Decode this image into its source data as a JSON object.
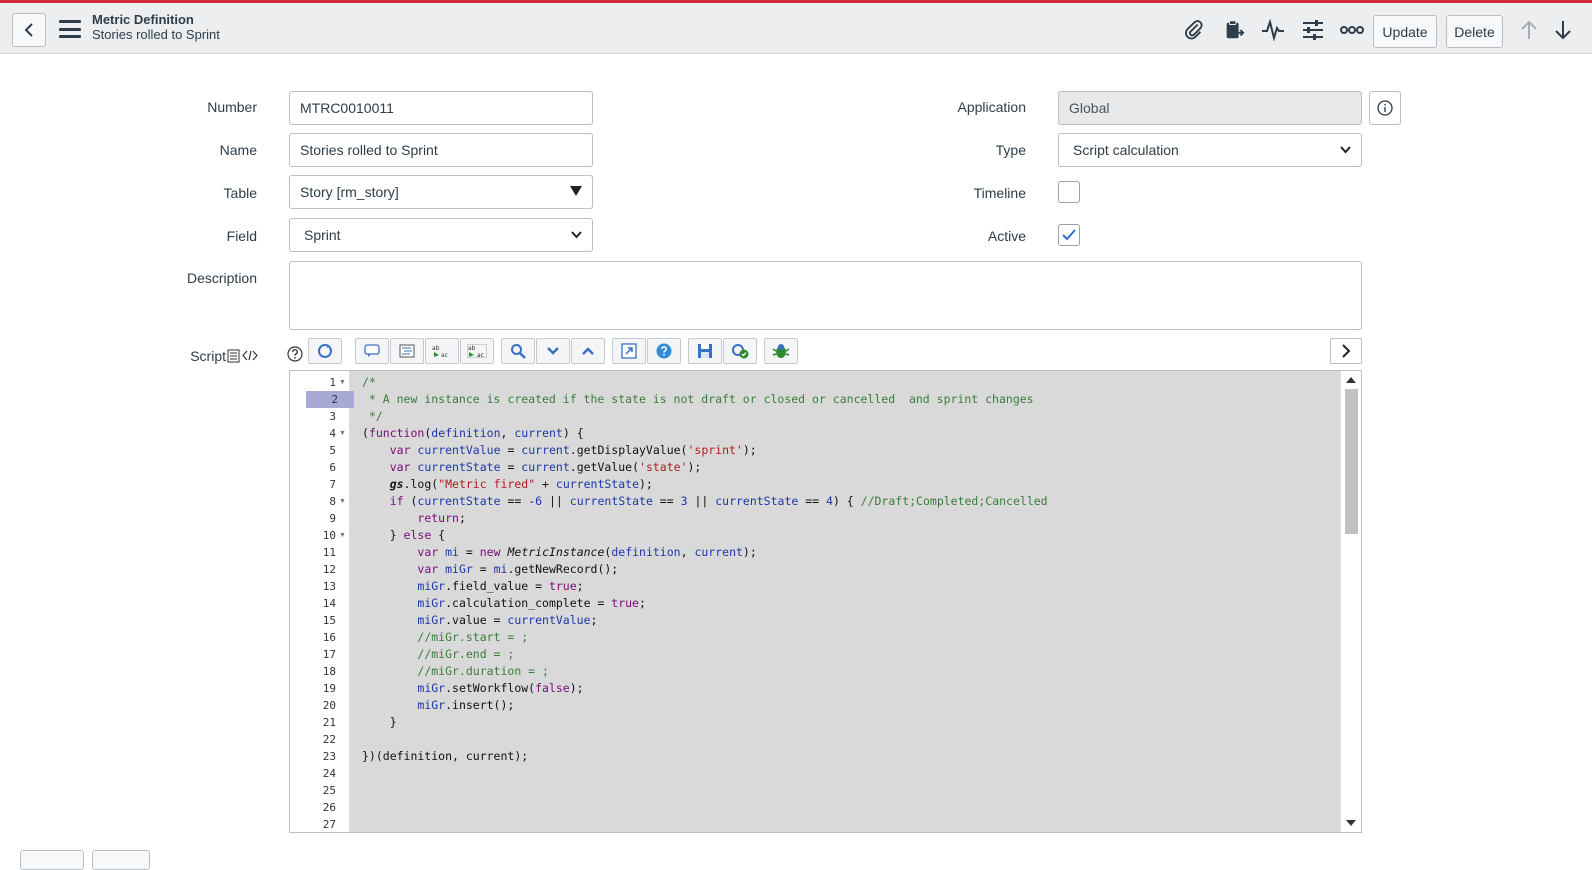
{
  "header": {
    "title": "Metric Definition",
    "subtitle": "Stories rolled to Sprint",
    "update_label": "Update",
    "delete_label": "Delete",
    "accent_color": "#d42d3c"
  },
  "form": {
    "number_label": "Number",
    "number_value": "MTRC0010011",
    "name_label": "Name",
    "name_value": "Stories rolled to Sprint",
    "table_label": "Table",
    "table_value": "Story [rm_story]",
    "field_label": "Field",
    "field_value": "Sprint",
    "description_label": "Description",
    "script_label": "Script",
    "application_label": "Application",
    "application_value": "Global",
    "type_label": "Type",
    "type_value": "Script calculation",
    "timeline_label": "Timeline",
    "active_label": "Active"
  },
  "editor": {
    "line_numbers": [
      "1",
      "2",
      "3",
      "4",
      "5",
      "6",
      "7",
      "8",
      "9",
      "10",
      "11",
      "12",
      "13",
      "14",
      "15",
      "16",
      "17",
      "18",
      "19",
      "20",
      "21",
      "22",
      "23",
      "24",
      "25",
      "26",
      "27"
    ],
    "active_line": "2"
  }
}
